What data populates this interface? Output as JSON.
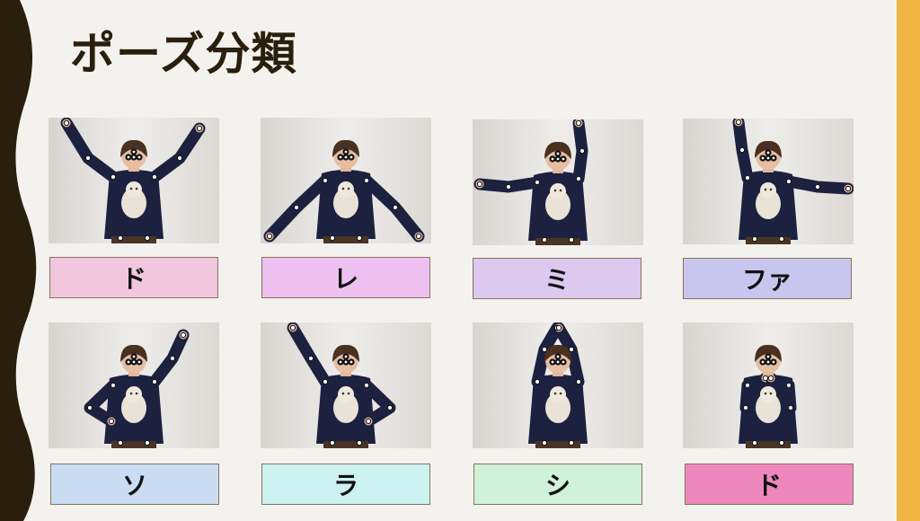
{
  "slide": {
    "title": "ポーズ分類",
    "colors": {
      "left_band": "#2a1e0c",
      "right_band": "#f0b544",
      "background": "#f3f2ef"
    },
    "poses": [
      {
        "label": "ド",
        "color": "#f2c6dc",
        "pose": "both-arms-up-v"
      },
      {
        "label": "レ",
        "color": "#eec0f2",
        "pose": "both-arms-down"
      },
      {
        "label": "ミ",
        "color": "#ddc8ef",
        "pose": "right-up-left-side"
      },
      {
        "label": "ファ",
        "color": "#c8c6ef",
        "pose": "left-up-right-side"
      },
      {
        "label": "ソ",
        "color": "#c9dcf2",
        "pose": "right-up-left-hip"
      },
      {
        "label": "ラ",
        "color": "#cdf2f2",
        "pose": "left-up-right-hip"
      },
      {
        "label": "シ",
        "color": "#cff2d9",
        "pose": "both-arms-overhead"
      },
      {
        "label": "ド",
        "color": "#ee87bd",
        "pose": "hands-on-chest"
      }
    ]
  }
}
